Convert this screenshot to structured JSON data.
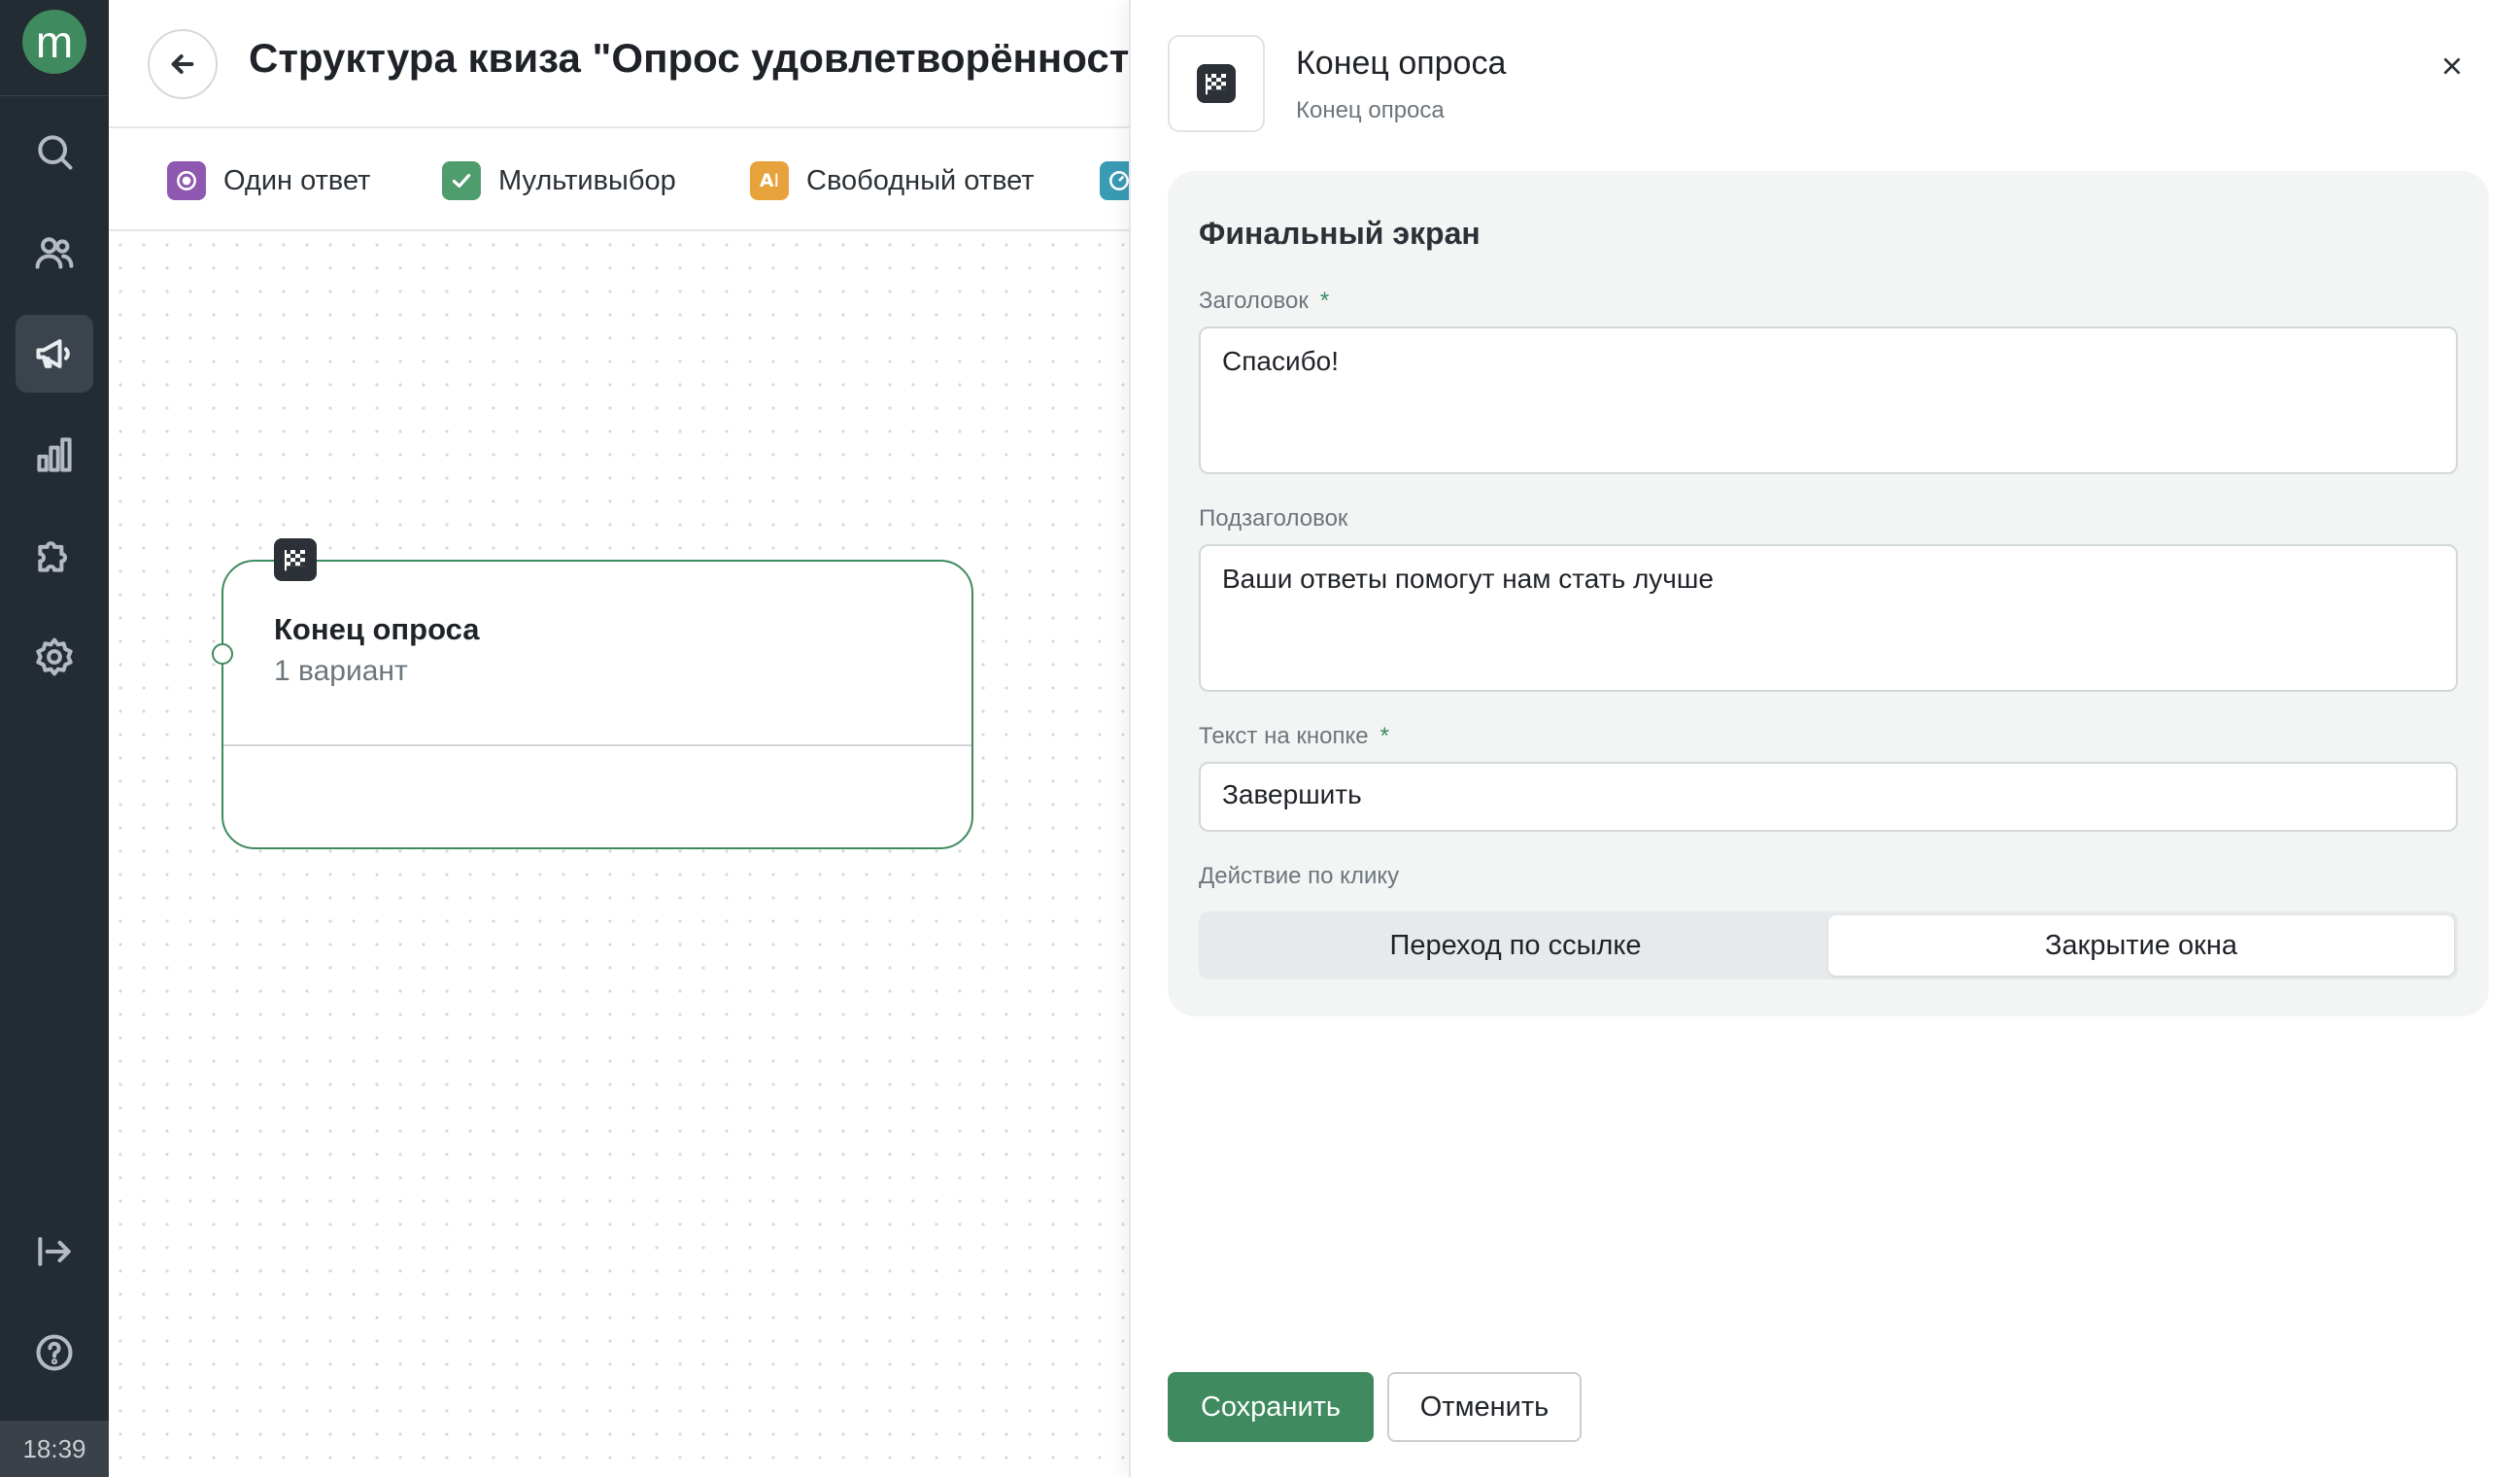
{
  "app": {
    "logo_letter": "m",
    "clock": "18:39"
  },
  "sidebar": {
    "items": [
      {
        "name": "search",
        "icon": "search-icon",
        "active": false
      },
      {
        "name": "users",
        "icon": "users-icon",
        "active": false
      },
      {
        "name": "campaigns",
        "icon": "megaphone-icon",
        "active": true
      },
      {
        "name": "analytics",
        "icon": "bar-chart-icon",
        "active": false
      },
      {
        "name": "integrations",
        "icon": "puzzle-icon",
        "active": false
      },
      {
        "name": "settings",
        "icon": "gear-icon",
        "active": false
      }
    ],
    "bottom_items": [
      {
        "name": "logout",
        "icon": "logout-icon"
      },
      {
        "name": "help",
        "icon": "help-icon"
      }
    ]
  },
  "header": {
    "title": "Структура квиза \"Опрос удовлетворённости"
  },
  "toolbar": {
    "tools": [
      {
        "label": "Один ответ",
        "icon": "radio-icon",
        "color": "#8e57b0"
      },
      {
        "label": "Мультивыбор",
        "icon": "checkbox-icon",
        "color": "#4f9c6c"
      },
      {
        "label": "Свободный ответ",
        "icon": "ai-icon",
        "color": "#e8a23c"
      },
      {
        "label": "",
        "icon": "rating-icon",
        "color": "#3a9bb5"
      }
    ]
  },
  "canvas": {
    "node": {
      "title": "Конец опроса",
      "subtitle": "1 вариант",
      "icon": "checkered-flag-icon"
    }
  },
  "drawer": {
    "title": "Конец опроса",
    "subtitle": "Конец опроса",
    "icon": "checkered-flag-icon",
    "section_title": "Финальный экран",
    "fields": {
      "heading": {
        "label": "Заголовок",
        "required_mark": "*",
        "value": "Спасибо!"
      },
      "subheading": {
        "label": "Подзаголовок",
        "value": "Ваши ответы помогут нам стать лучше"
      },
      "button_text": {
        "label": "Текст на кнопке",
        "required_mark": "*",
        "value": "Завершить"
      }
    },
    "click_action": {
      "label": "Действие по клику",
      "options": [
        "Переход по ссылке",
        "Закрытие окна"
      ],
      "selected": "Закрытие окна"
    },
    "save_label": "Сохранить",
    "cancel_label": "Отменить"
  },
  "colors": {
    "accent": "#3f8a5f",
    "sidebar_bg": "#232b33"
  }
}
